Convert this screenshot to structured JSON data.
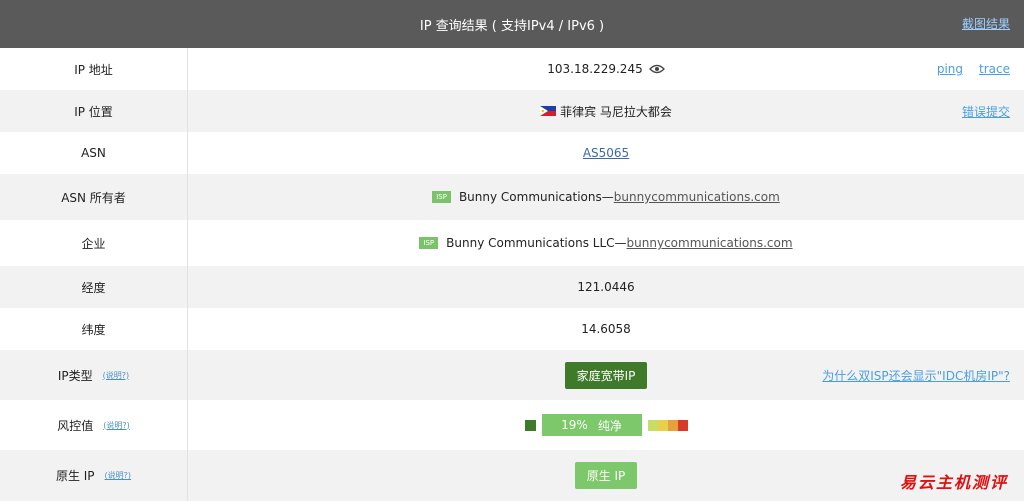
{
  "header": {
    "title": "IP 查询结果 ( 支持IPv4 / IPv6 )",
    "screenshot_link": "截图结果"
  },
  "rows": {
    "ip": {
      "label": "IP 地址",
      "value": "103.18.229.245",
      "links": [
        "ping",
        "trace"
      ]
    },
    "location": {
      "label": "IP 位置",
      "value": "菲律宾 马尼拉大都会",
      "link": "错误提交"
    },
    "asn": {
      "label": "ASN",
      "value": "AS5065"
    },
    "asn_owner": {
      "label": "ASN 所有者",
      "badge": "ISP",
      "name": "Bunny Communications— ",
      "domain": "bunnycommunications.com"
    },
    "company": {
      "label": "企业",
      "badge": "ISP",
      "name": "Bunny Communications LLC— ",
      "domain": "bunnycommunications.com"
    },
    "longitude": {
      "label": "经度",
      "value": "121.0446"
    },
    "latitude": {
      "label": "纬度",
      "value": "14.6058"
    },
    "ip_type": {
      "label": "IP类型",
      "explain": "(说明?)",
      "value": "家庭宽带IP",
      "link": "为什么双ISP还会显示\"IDC机房IP\"?"
    },
    "risk": {
      "label": "风控值",
      "explain": "(说明?)",
      "percent": "19%",
      "status": "纯净",
      "level": 0.19
    },
    "native": {
      "label": "原生 IP",
      "explain": "(说明?)",
      "value": "原生 IP"
    }
  },
  "watermark": "易云主机测评",
  "colors": {
    "header_bg": "#5a5a5a",
    "green_dark": "#3f7a2a",
    "green_light": "#7cc86a",
    "link_blue": "#4a9ee0"
  }
}
